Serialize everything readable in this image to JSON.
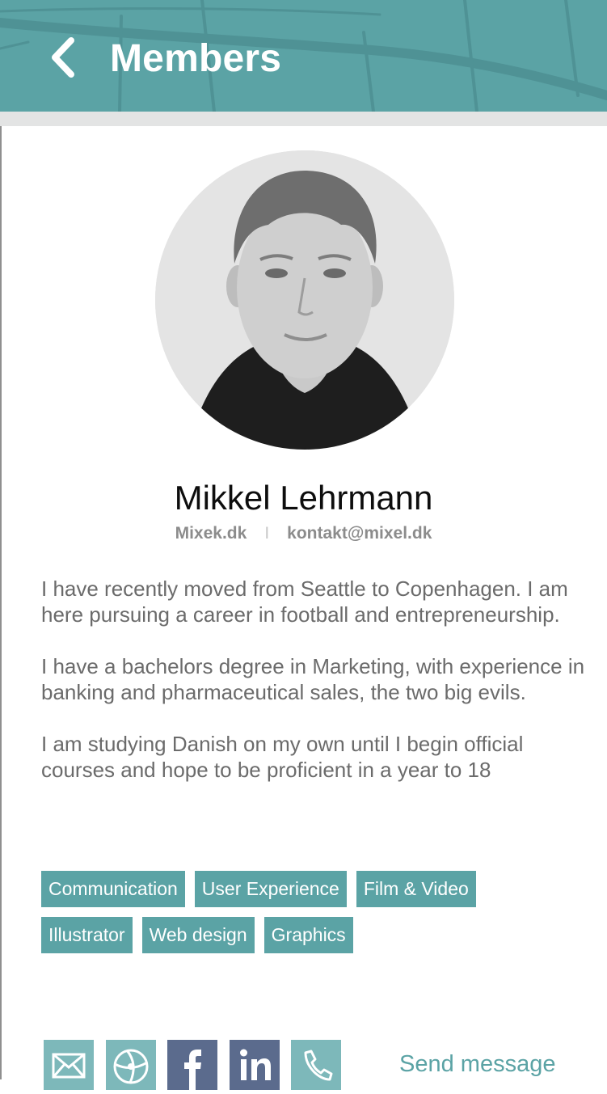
{
  "header": {
    "title": "Members",
    "back_icon": "chevron-left-icon",
    "background_color": "#5ba3a5"
  },
  "profile": {
    "name": "Mikkel Lehrmann",
    "website": "Mixek.dk",
    "separator": "I",
    "email": "kontakt@mixel.dk",
    "bio": [
      "I have recently moved from Seattle to Copenhagen. I am here pursuing a career in football and entrepreneurship.",
      "I have a bachelors degree in Marketing, with experience in banking and pharmaceutical sales, the two big evils.",
      "I am studying Danish on my own until I begin official courses and hope to be proficient in a year to 18"
    ]
  },
  "tags": {
    "row1": [
      "Communication",
      "User Experience",
      "Film & Video"
    ],
    "row2": [
      "Illustrator",
      "Web design",
      "Graphics"
    ]
  },
  "actions": {
    "icons": [
      "mail-icon",
      "globe-icon",
      "facebook-icon",
      "linkedin-icon",
      "phone-icon"
    ],
    "send_label": "Send message"
  },
  "colors": {
    "accent": "#5ba3a5",
    "social_dark": "#5b6b8d"
  }
}
